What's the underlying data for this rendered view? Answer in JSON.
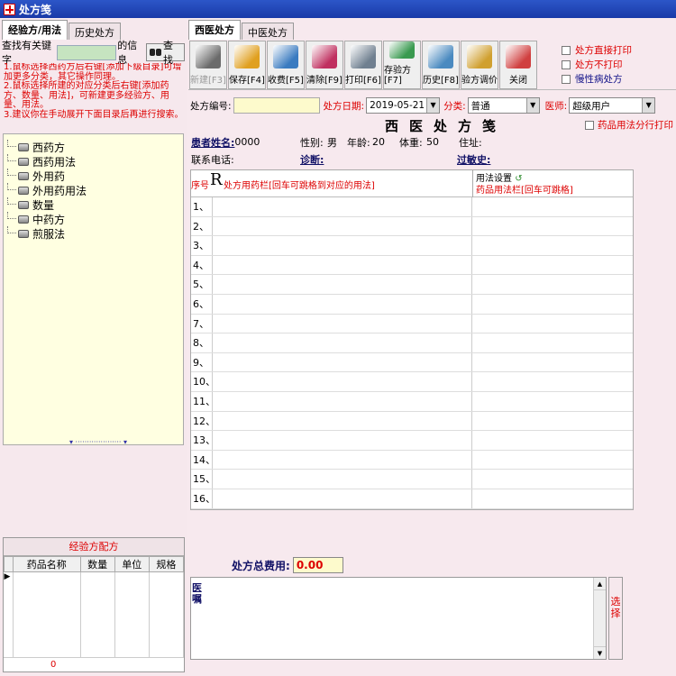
{
  "window": {
    "title": "处方笺"
  },
  "left": {
    "tabs": [
      "经验方/用法",
      "历史处方"
    ],
    "search": {
      "prefix": "查找有关键字",
      "suffix": "的信息",
      "value": "",
      "button": "查找"
    },
    "notes": [
      "1.鼠标选择西药方后右键[添加下级目录]可增加更多分类，其它操作同理。",
      "2.鼠标选择所建的对应分类后右键[添加药方、数量、用法]，可新建更多经验方、用量、用法。",
      "3.建议你在手动展开下面目录后再进行搜索。"
    ],
    "tree": [
      "西药方",
      "西药用法",
      "外用药",
      "外用药用法",
      "数量",
      "中药方",
      "煎服法"
    ],
    "formula": {
      "title": "经验方配方",
      "columns": [
        "药品名称",
        "数量",
        "单位",
        "规格"
      ],
      "footer_value": "0"
    }
  },
  "right": {
    "tabs": [
      "西医处方",
      "中医处方"
    ],
    "toolbar": [
      {
        "label": "新建[F3]",
        "icon": "new-icon",
        "color": "#6b6b6b",
        "disabled": true
      },
      {
        "label": "保存[F4]",
        "icon": "save-icon",
        "color": "#e0a020"
      },
      {
        "label": "收费[F5]",
        "icon": "fee-icon",
        "color": "#3a7bc0"
      },
      {
        "label": "清除[F9]",
        "icon": "clear-icon",
        "color": "#c03060"
      },
      {
        "label": "打印[F6]",
        "icon": "print-icon",
        "color": "#708090"
      },
      {
        "label": "存验方[F7]",
        "icon": "save-formula-icon",
        "color": "#3a9a50"
      },
      {
        "label": "历史[F8]",
        "icon": "history-icon",
        "color": "#4a8ac0"
      },
      {
        "label": "验方调价",
        "icon": "adjust-price-icon",
        "color": "#d0a030"
      },
      {
        "label": "关闭",
        "icon": "close-icon",
        "color": "#d04040"
      }
    ],
    "options": [
      {
        "label": "处方直接打印",
        "style": "red"
      },
      {
        "label": "处方不打印",
        "style": "red"
      },
      {
        "label": "慢性病处方",
        "style": "blue"
      }
    ],
    "form": {
      "rx_no_label": "处方编号:",
      "rx_no_value": "",
      "date_label": "处方日期:",
      "date_value": "2019-05-21",
      "category_label": "分类:",
      "category_value": "普通",
      "doctor_label": "医师:",
      "doctor_value": "超级用户"
    },
    "rx_title": "西医处方笺",
    "split_print_label": "药品用法分行打印",
    "patient": {
      "name_label": "患者姓名:",
      "name_value": "0000",
      "gender_label": "性别:",
      "gender_value": "男",
      "age_label": "年龄:",
      "age_value": "20",
      "weight_label": "体重:",
      "weight_value": "50",
      "address_label": "住址:",
      "phone_label": "联系电话:",
      "diagnosis_label": "诊断:",
      "allergy_label": "过敏史:"
    },
    "rx_table": {
      "seq_label": "序号",
      "rx_symbol": "R",
      "drug_col_label": "处方用药栏[回车可跳格到对应的用法]",
      "usage_settings_label": "用法设置",
      "usage_col_label": "药品用法栏[回车可跳格]",
      "rows": [
        "1、",
        "2、",
        "3、",
        "4、",
        "5、",
        "6、",
        "7、",
        "8、",
        "9、",
        "10、",
        "11、",
        "12、",
        "13、",
        "14、",
        "15、",
        "16、"
      ]
    },
    "total": {
      "label": "处方总费用:",
      "value": "0.00"
    },
    "advice": {
      "label": "医嘱",
      "choose_label": "选择"
    }
  }
}
